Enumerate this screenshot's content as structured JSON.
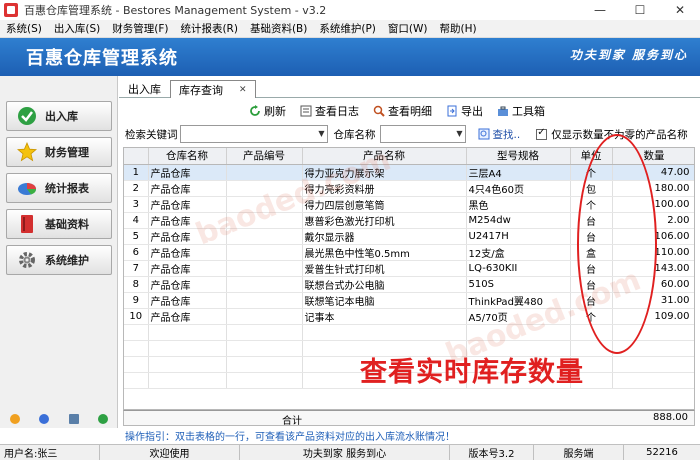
{
  "window": {
    "title": "百惠仓库管理系统 - Bestores Management System - v3.2"
  },
  "menubar": [
    "系统(S)",
    "出入库(S)",
    "财务管理(F)",
    "统计报表(R)",
    "基础资料(B)",
    "系统维护(P)",
    "窗口(W)",
    "帮助(H)"
  ],
  "banner": {
    "title": "百惠仓库管理系统",
    "slogan": "功夫到家 服务到心"
  },
  "sidebar": [
    {
      "label": "出入库",
      "icon": "check-icon"
    },
    {
      "label": "财务管理",
      "icon": "star-icon"
    },
    {
      "label": "统计报表",
      "icon": "pie-chart-icon"
    },
    {
      "label": "基础资料",
      "icon": "book-icon"
    },
    {
      "label": "系统维护",
      "icon": "gear-icon"
    }
  ],
  "tabs": [
    {
      "label": "出入库"
    },
    {
      "label": "库存查询"
    }
  ],
  "toolbar": {
    "refresh": "刷新",
    "view_log": "查看日志",
    "view_detail": "查看明细",
    "export": "导出",
    "toolbox": "工具箱"
  },
  "search": {
    "keyword_label": "检索关键词",
    "keyword_value": "",
    "warehouse_label": "仓库名称",
    "warehouse_value": "",
    "search_button": "查找..",
    "nonzero_label": "仅显示数量不为零的产品名称",
    "nonzero_checked": true
  },
  "table": {
    "columns": [
      "",
      "仓库名称",
      "产品编号",
      "产品名称",
      "型号规格",
      "单位",
      "数量"
    ],
    "rows": [
      [
        "1",
        "产品仓库",
        "",
        "得力亚克力展示架",
        "三层A4",
        "个",
        "47.00"
      ],
      [
        "2",
        "产品仓库",
        "",
        "得力亮彩资料册",
        "4只4色60页",
        "包",
        "180.00"
      ],
      [
        "3",
        "产品仓库",
        "",
        "得力四层创意笔筒",
        "黑色",
        "个",
        "100.00"
      ],
      [
        "4",
        "产品仓库",
        "",
        "惠普彩色激光打印机",
        "M254dw",
        "台",
        "2.00"
      ],
      [
        "5",
        "产品仓库",
        "",
        "戴尔显示器",
        "U2417H",
        "台",
        "106.00"
      ],
      [
        "6",
        "产品仓库",
        "",
        "晨光黑色中性笔0.5mm",
        "12支/盒",
        "盒",
        "110.00"
      ],
      [
        "7",
        "产品仓库",
        "",
        "爱普生针式打印机",
        "LQ-630KII",
        "台",
        "143.00"
      ],
      [
        "8",
        "产品仓库",
        "",
        "联想台式办公电脑",
        "510S",
        "台",
        "60.00"
      ],
      [
        "9",
        "产品仓库",
        "",
        "联想笔记本电脑",
        "ThinkPad翼480",
        "台",
        "31.00"
      ],
      [
        "10",
        "产品仓库",
        "",
        "记事本",
        "A5/70页",
        "个",
        "109.00"
      ]
    ],
    "total_label": "合计",
    "total_value": "888.00"
  },
  "hint": "操作指引：双击表格的一行，可查看该产品资料对应的出入库流水账情况！",
  "status": {
    "user": "用户名:张三",
    "welcome": "欢迎使用",
    "slogan": "功夫到家 服务到心",
    "version": "版本号3.2",
    "server": "服务端",
    "port": "52216"
  },
  "annotation": {
    "text": "查看实时库存数量",
    "color": "#e02020"
  },
  "watermark": "baoded.com",
  "colors": {
    "banner": "#2f7fd0",
    "hint": "#1f5fb8",
    "annotation": "#e02020"
  }
}
